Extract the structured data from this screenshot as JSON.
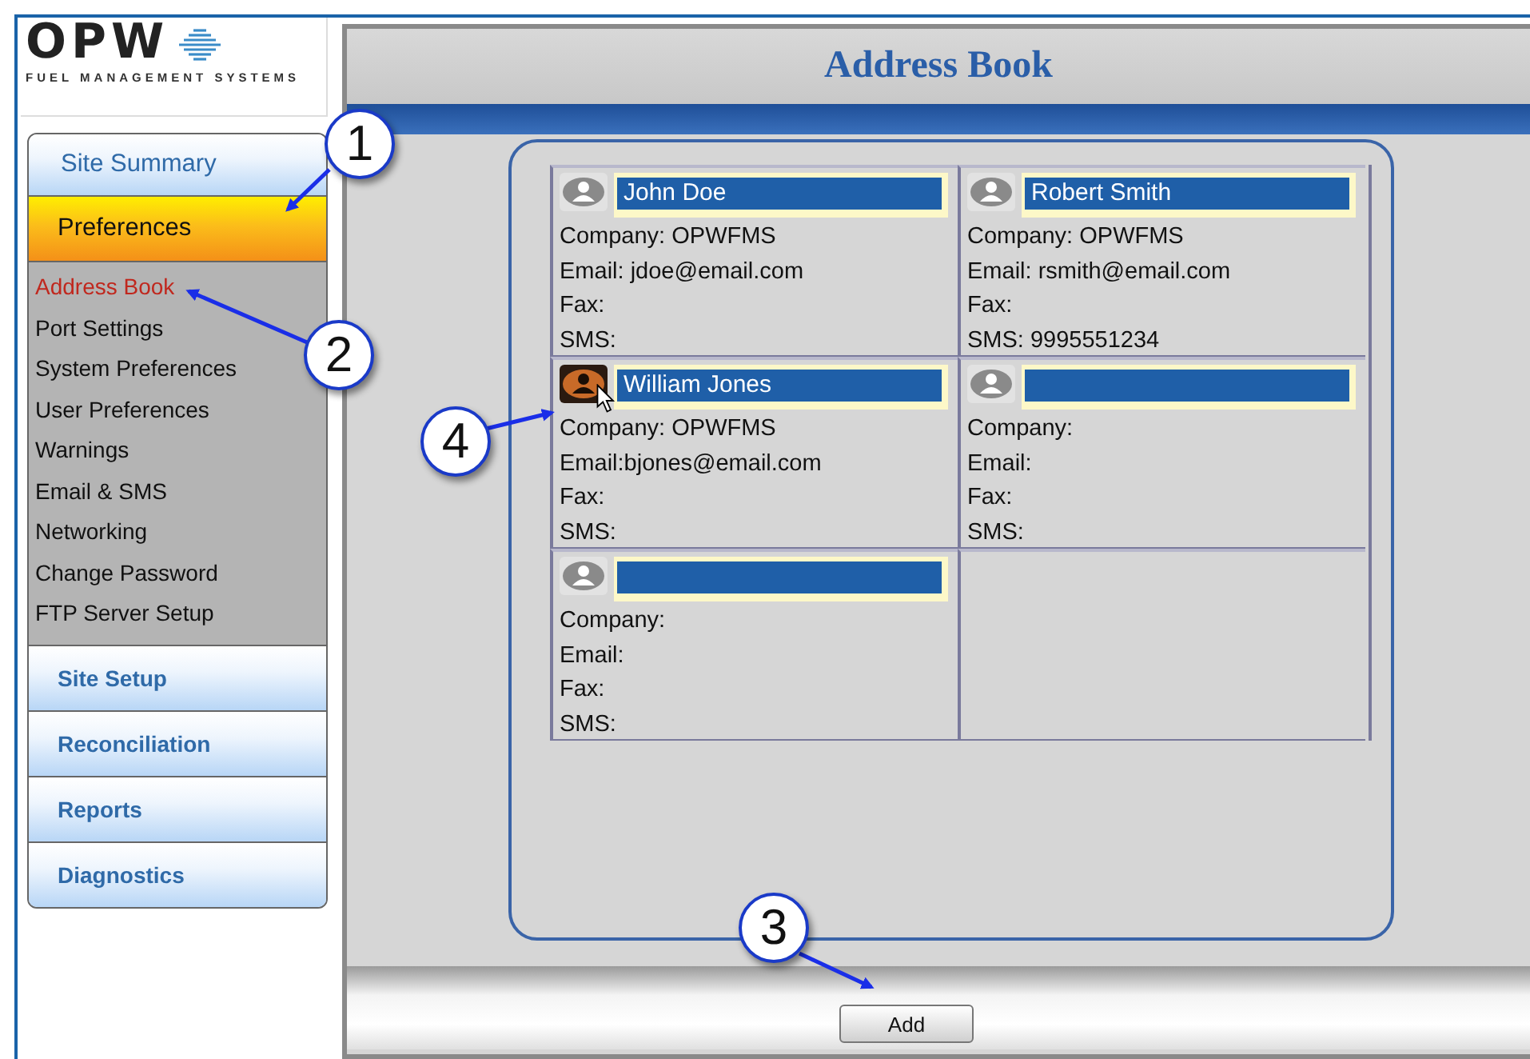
{
  "logo": {
    "mark": "OPW",
    "tagline": "FUEL MANAGEMENT SYSTEMS"
  },
  "menu": [
    {
      "label": "Site Summary",
      "kind": "summary",
      "selected": false
    },
    {
      "label": "Preferences",
      "kind": "section",
      "selected": true,
      "children": [
        {
          "label": "Address Book",
          "selected": true
        },
        {
          "label": "Port Settings",
          "selected": false
        },
        {
          "label": "System Preferences",
          "selected": false
        },
        {
          "label": "User Preferences",
          "selected": false
        },
        {
          "label": "Warnings",
          "selected": false
        },
        {
          "label": "Email & SMS",
          "selected": false
        },
        {
          "label": "Networking",
          "selected": false
        },
        {
          "label": "Change Password",
          "selected": false
        },
        {
          "label": "FTP Server Setup",
          "selected": false
        }
      ]
    },
    {
      "label": "Site Setup",
      "kind": "section",
      "selected": false
    },
    {
      "label": "Reconciliation",
      "kind": "section",
      "selected": false
    },
    {
      "label": "Reports",
      "kind": "section",
      "selected": false
    },
    {
      "label": "Diagnostics",
      "kind": "section",
      "selected": false
    }
  ],
  "page_title": "Address Book",
  "contacts": [
    {
      "name": "John Doe",
      "hovered": false,
      "lines": [
        "Company: OPWFMS",
        "Email: jdoe@email.com",
        "Fax:",
        "SMS:"
      ]
    },
    {
      "name": "Robert Smith",
      "hovered": false,
      "lines": [
        "Company: OPWFMS",
        "Email: rsmith@email.com",
        "Fax:",
        "SMS: 9995551234"
      ]
    },
    {
      "name": "William Jones",
      "hovered": true,
      "lines": [
        "Company: OPWFMS",
        "Email:bjones@email.com",
        "Fax:",
        "SMS:"
      ]
    },
    {
      "hovered": false,
      "lines": [
        "Company:",
        "Email:",
        "Fax:",
        "SMS:"
      ]
    },
    {
      "hovered": false,
      "lines": [
        "Company:",
        "Email:",
        "Fax:",
        "SMS:"
      ]
    }
  ],
  "add_button": "Add",
  "callouts": [
    {
      "number": "1"
    },
    {
      "number": "2"
    },
    {
      "number": "3"
    },
    {
      "number": "4"
    }
  ]
}
